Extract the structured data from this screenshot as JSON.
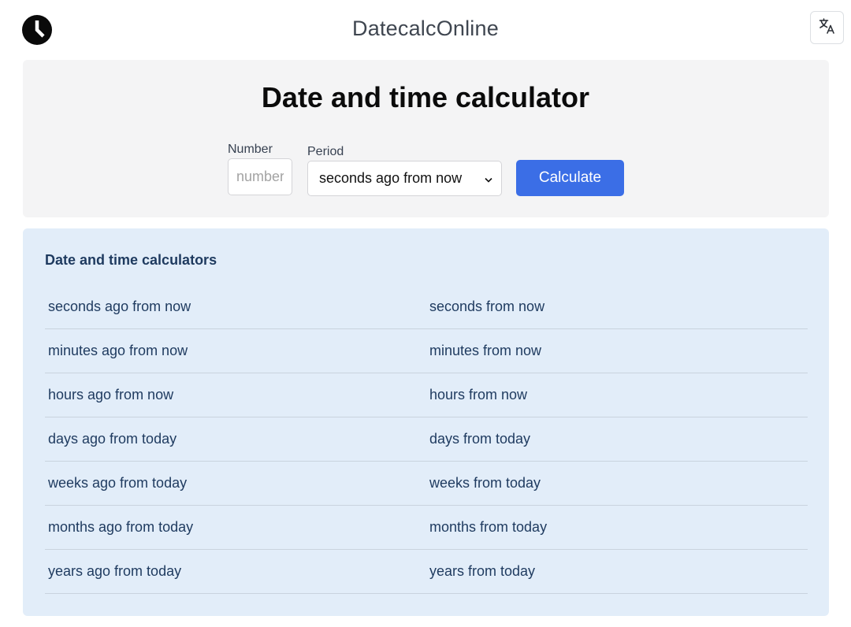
{
  "header": {
    "site_title": "DatecalcOnline",
    "logo_icon": "clock-icon",
    "language_icon": "translate-icon"
  },
  "calculator": {
    "title": "Date and time calculator",
    "number_label": "Number",
    "number_placeholder": "number",
    "number_value": "",
    "period_label": "Period",
    "period_selected": "seconds ago from now",
    "calculate_label": "Calculate"
  },
  "links": {
    "heading": "Date and time calculators",
    "items": [
      "seconds ago from now",
      "seconds from now",
      "minutes ago from now",
      "minutes from now",
      "hours ago from now",
      "hours from now",
      "days ago from today",
      "days from today",
      "weeks ago from today",
      "weeks from today",
      "months ago from today",
      "months from today",
      "years ago from today",
      "years from today"
    ]
  },
  "colors": {
    "accent": "#3b6ee6",
    "link_text": "#1e3a5f",
    "links_panel_bg": "#e2edf9",
    "calc_panel_bg": "#f4f4f5"
  }
}
